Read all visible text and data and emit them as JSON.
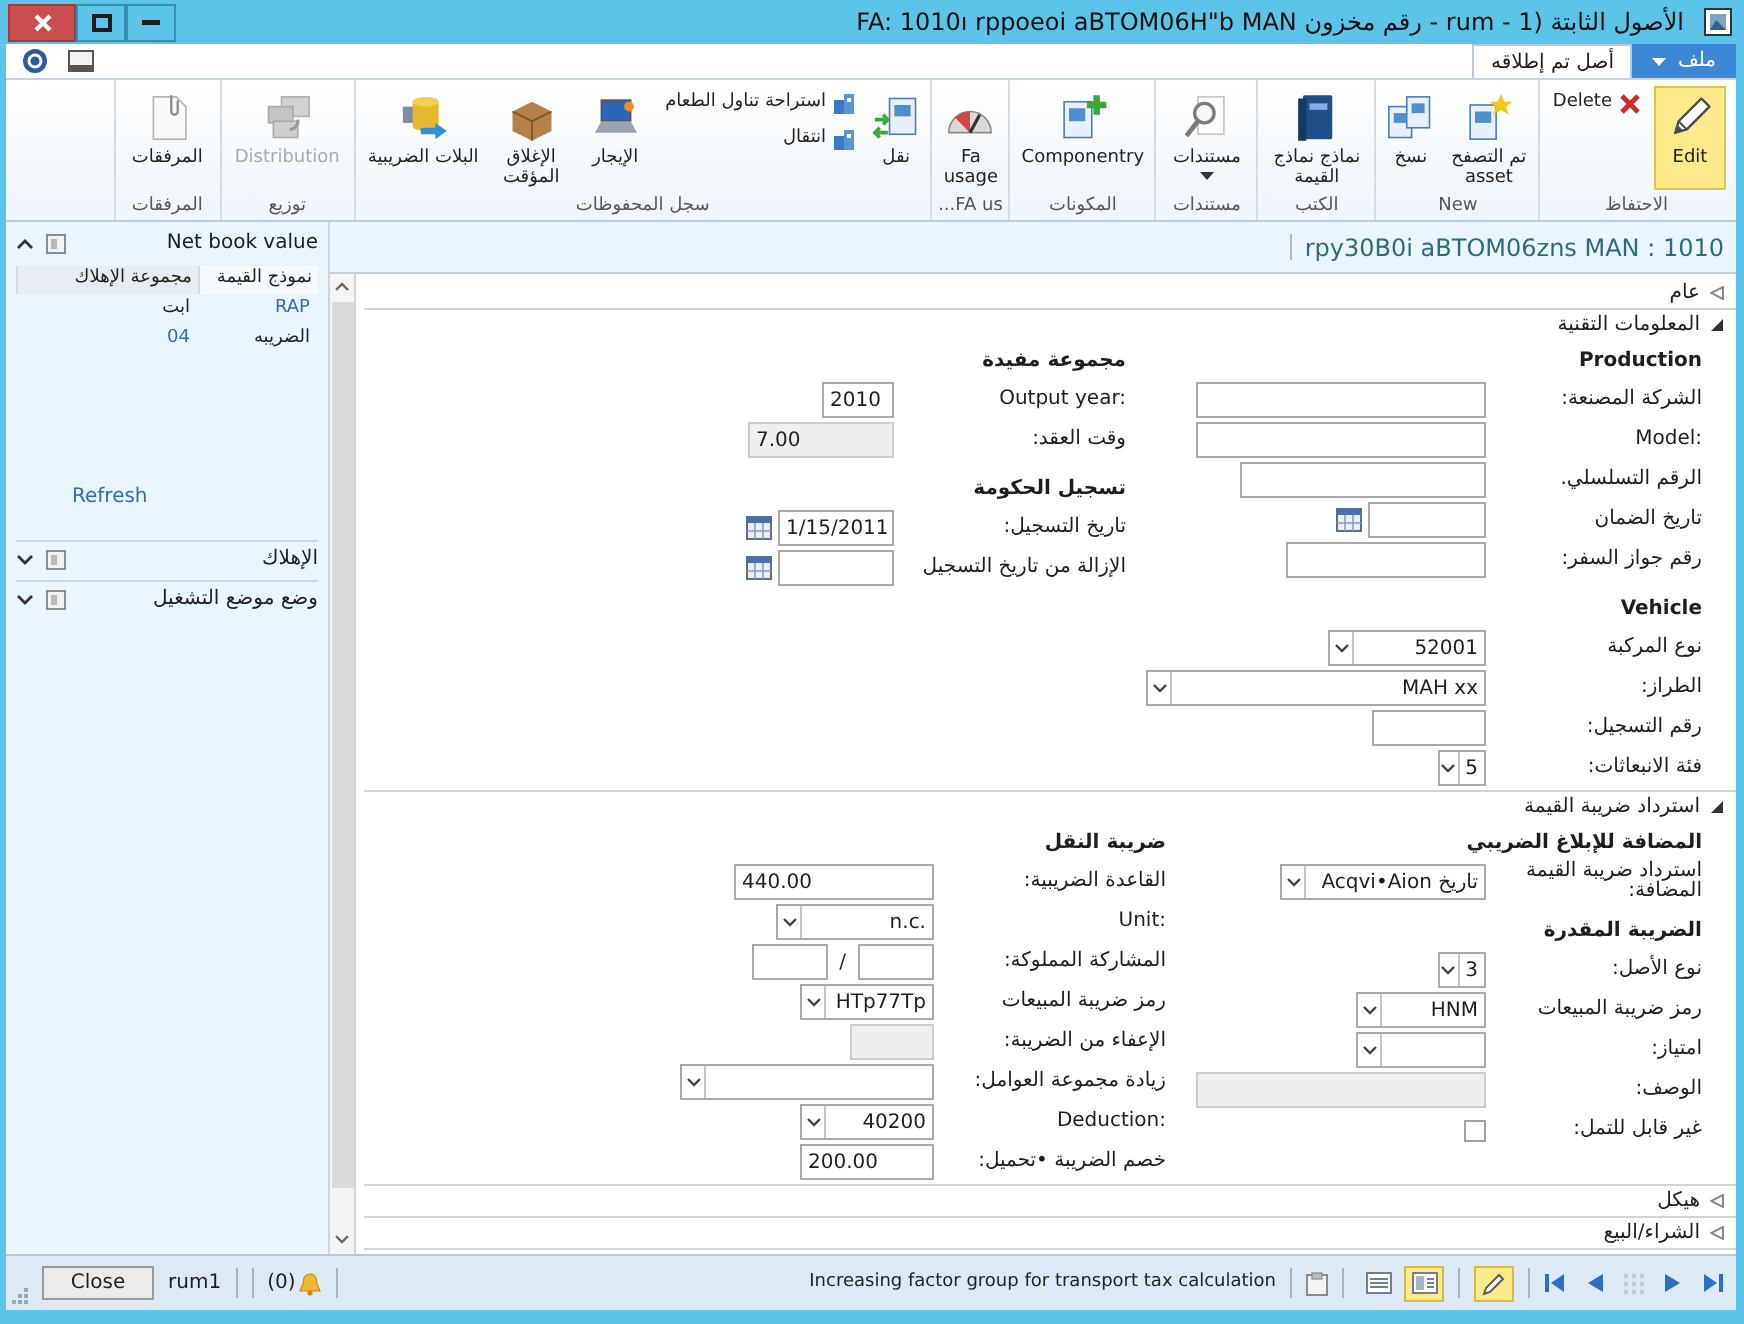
{
  "window": {
    "title": "FA: 1010ı rppoeoi aBTOM06H\"b MAN رقم مخزون - rum - 1) الأصول الثابتة"
  },
  "ribbon_tabs": [
    {
      "label": "ملف",
      "kind": "file",
      "selected": false
    },
    {
      "label": "أصل تم إطلاقه",
      "kind": "tab",
      "selected": true
    }
  ],
  "ribbon_groups": [
    {
      "label": "الاحتفاظ",
      "buttons": [
        {
          "label": "Edit",
          "kind": "large",
          "on": true,
          "disabled": false
        },
        {
          "label": "Delete",
          "kind": "small",
          "on": false,
          "disabled": false
        }
      ]
    },
    {
      "label": "New",
      "buttons": [
        {
          "label": "تم التصفح asset",
          "kind": "large",
          "on": false,
          "disabled": false
        },
        {
          "label": "نسخ",
          "kind": "large",
          "on": false,
          "disabled": false
        }
      ]
    },
    {
      "label": "الكتب",
      "buttons": [
        {
          "label": "نماذج نماذج القيمة",
          "kind": "large",
          "on": false,
          "disabled": false
        }
      ]
    },
    {
      "label": "مستندات",
      "buttons": [
        {
          "label": "مستندات",
          "kind": "menu",
          "on": false,
          "disabled": false
        }
      ]
    },
    {
      "label": "المكونات",
      "buttons": [
        {
          "label": "Componentry",
          "kind": "large",
          "on": false,
          "disabled": false
        }
      ]
    },
    {
      "label": "FA us...",
      "buttons": [
        {
          "label": "Fa usage",
          "kind": "large",
          "on": false,
          "disabled": false
        }
      ]
    },
    {
      "label": "سجل المحفوظات",
      "buttons": [
        {
          "label": "نقل",
          "kind": "large",
          "on": false,
          "disabled": false
        },
        {
          "label": "استراحة تناول الطعام",
          "kind": "small",
          "on": false,
          "disabled": false
        },
        {
          "label": "انتقال",
          "kind": "small",
          "on": false,
          "disabled": false
        },
        {
          "label": "الإيجار",
          "kind": "large",
          "on": false,
          "disabled": false
        },
        {
          "label": "الإغلاق المؤقت",
          "kind": "large",
          "on": false,
          "disabled": false
        },
        {
          "label": "البلات الضريبية",
          "kind": "large",
          "on": false,
          "disabled": false
        }
      ]
    },
    {
      "label": "توزيع",
      "buttons": [
        {
          "label": "Distribution",
          "kind": "large",
          "on": false,
          "disabled": true
        }
      ]
    },
    {
      "label": "المرفقات",
      "buttons": [
        {
          "label": "المرفقات",
          "kind": "large",
          "on": false,
          "disabled": false
        }
      ]
    }
  ],
  "factboxes": [
    {
      "title": "Net book value",
      "expanded": true,
      "columns": [
        "نموذج القيمة",
        "مجموعة الإهلاك"
      ],
      "rows": [
        [
          {
            "text": "RAP",
            "link": true
          },
          {
            "text": "ابت",
            "link": false
          }
        ],
        [
          {
            "text": "الضريبه",
            "link": false
          },
          {
            "text": "04",
            "link": true
          }
        ]
      ],
      "action": "Refresh"
    },
    {
      "title": "الإهلاك",
      "expanded": false
    },
    {
      "title": "وضع موضع التشغيل",
      "expanded": false
    }
  ],
  "page_header": {
    "title": "rpy30B0i aBTOM06zns MAN : 1010"
  },
  "fasttabs": [
    {
      "title": "عام",
      "expanded": false
    },
    {
      "title": "المعلومات التقنية",
      "expanded": true,
      "columns": [
        [
          {
            "kind": "heading",
            "label": "Production"
          },
          {
            "kind": "text",
            "label": "الشركة المصنعة:",
            "readonly": false
          },
          {
            "kind": "text",
            "label": "Model:",
            "readonly": false
          },
          {
            "kind": "text",
            "label": "الرقم التسلسلي.",
            "readonly": false
          },
          {
            "kind": "date",
            "label": "تاريخ الضمان",
            "readonly": false
          },
          {
            "kind": "text",
            "label": "رقم جواز السفر:",
            "readonly": false
          },
          {
            "kind": "heading",
            "label": "Vehicle"
          },
          {
            "kind": "combo",
            "label": "نوع المركبة",
            "value": "52001",
            "readonly": false
          },
          {
            "kind": "combo",
            "label": "الطراز:",
            "value": "MAH xx",
            "readonly": false
          },
          {
            "kind": "text",
            "label": "رقم التسجيل:",
            "readonly": false
          },
          {
            "kind": "combo",
            "label": "فئة الانبعاثات:",
            "value": "5",
            "readonly": false
          }
        ],
        [
          {
            "kind": "heading",
            "label": "مجموعة مفيدة"
          },
          {
            "kind": "number",
            "label": "Output year:",
            "value": "2010",
            "readonly": false
          },
          {
            "kind": "number",
            "label": "وقت العقد:",
            "value": "7.00",
            "readonly": true
          },
          {
            "kind": "heading",
            "label": "تسجيل الحكومة"
          },
          {
            "kind": "date",
            "label": "تاريخ التسجيل:",
            "value": "1/15/2011",
            "readonly": false
          },
          {
            "kind": "date",
            "label": "الإزالة من تاريخ التسجيل",
            "readonly": false
          }
        ]
      ]
    },
    {
      "title": "استرداد ضريبة القيمة",
      "expanded": true,
      "columns": [
        [
          {
            "kind": "heading",
            "label": "المضافة للإبلاغ الضريبي"
          },
          {
            "kind": "combo",
            "label": "استرداد ضريبة القيمة المضافة:",
            "value": "تاريخ Acqvi•Aion",
            "readonly": false
          },
          {
            "kind": "heading",
            "label": "الضريبة المقدرة"
          },
          {
            "kind": "combo",
            "label": "نوع الأصل:",
            "value": "3",
            "readonly": false
          },
          {
            "kind": "combo",
            "label": "رمز ضريبة المبيعات",
            "value": "HNM",
            "readonly": false
          },
          {
            "kind": "combo",
            "label": "امتياز:",
            "readonly": false
          },
          {
            "kind": "text",
            "label": "الوصف:",
            "readonly": true
          },
          {
            "kind": "checkbox",
            "label": "غير قابل للتمل:",
            "checked": false
          }
        ],
        [
          {
            "kind": "heading",
            "label": "ضريبة النقل"
          },
          {
            "kind": "number",
            "label": "القاعدة الضريبية:",
            "value": "440.00",
            "readonly": false
          },
          {
            "kind": "combo",
            "label": "Unit:",
            "value": "n.c.",
            "readonly": false
          },
          {
            "kind": "pair",
            "label": "المشاركة المملوكة:",
            "separator": "/",
            "readonly": false
          },
          {
            "kind": "combo",
            "label": "رمز ضريبة المبيعات",
            "value": "HTp77Tp",
            "readonly": false
          },
          {
            "kind": "text",
            "label": "الإعفاء من الضريبة:",
            "readonly": true
          },
          {
            "kind": "combo",
            "label": "زيادة مجموعة العوامل:",
            "readonly": false
          },
          {
            "kind": "combo",
            "label": "Deduction:",
            "value": "40200",
            "readonly": false
          },
          {
            "kind": "number",
            "label": "خصم الضريبة •تحميل:",
            "value": "200.00",
            "readonly": false
          }
        ]
      ]
    },
    {
      "title": "هيكل",
      "expanded": false
    },
    {
      "title": "الشراء/البيع",
      "expanded": false
    }
  ],
  "status_bar": {
    "close_button": "Close",
    "user": "rum1",
    "alerts": "(0)",
    "message": "Increasing factor group for transport tax calculation",
    "edit_mode": true,
    "views": [
      {
        "selected": false
      },
      {
        "selected": true
      }
    ]
  }
}
